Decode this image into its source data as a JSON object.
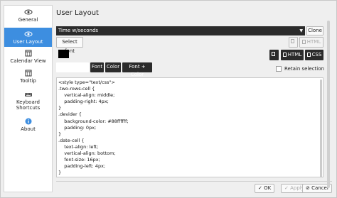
{
  "window": {
    "title": "User Layout"
  },
  "sidebar": {
    "items": [
      {
        "label": "General",
        "icon": "eye-icon"
      },
      {
        "label": "User Layout",
        "icon": "eye-icon"
      },
      {
        "label": "Calendar View",
        "icon": "calendar-icon"
      },
      {
        "label": "Tooltip",
        "icon": "calendar-icon"
      },
      {
        "label": "Keyboard Shortcuts",
        "icon": "keyboard-icon"
      },
      {
        "label": "About",
        "icon": "info-icon"
      }
    ]
  },
  "layout_select": {
    "value": "Time w/seconds"
  },
  "buttons": {
    "clone": "Clone",
    "select_font": "Select font",
    "html_disabled": "HTML",
    "html": "HTML",
    "css": "CSS",
    "tab_hidden": "Font",
    "font": "Font",
    "color": "Color",
    "font_color": "Font + Color"
  },
  "retain_selection": {
    "label": "Retain selection",
    "checked": false
  },
  "editor": {
    "lines": [
      "<style type=\"text/css\">",
      ".two-rows-cell {",
      "    vertical-align: middle;",
      "    padding-right: 4px;",
      "}",
      ".devider {",
      "    background-color: #88ffffff;",
      "    padding: 0px;",
      "}",
      ".date-cell {",
      "    text-align: left;",
      "    vertical-align: bottom;",
      "    font-size: 16px;",
      "    padding-left: 4px;",
      "}"
    ]
  },
  "footer": {
    "ok": "OK",
    "apply": "Apply",
    "cancel": "Cancel"
  },
  "colors": {
    "accent": "#3d8ee0",
    "dark": "#2b2b2b",
    "swatch": "#000000"
  }
}
